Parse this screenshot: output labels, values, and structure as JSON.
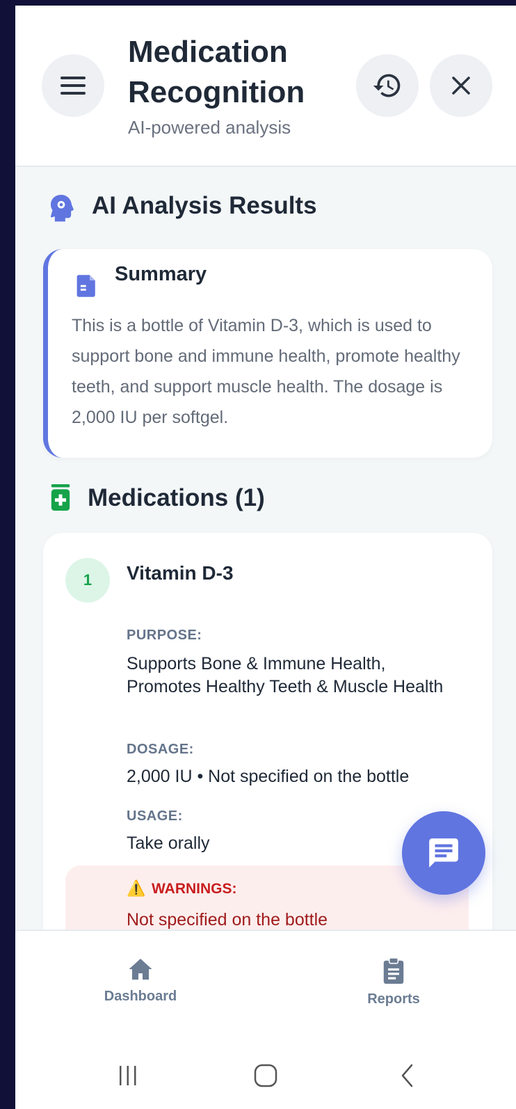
{
  "header": {
    "title": "Medication Recognition",
    "subtitle": "AI-powered analysis"
  },
  "analysis": {
    "title": "AI Analysis Results"
  },
  "summary": {
    "title": "Summary",
    "text": "This is a bottle of Vitamin D-3, which is used to support bone and immune health, promote healthy teeth, and support muscle health. The dosage is 2,000 IU per softgel."
  },
  "medications": {
    "title": "Medications (1)",
    "items": [
      {
        "number": "1",
        "name": "Vitamin D-3",
        "purpose_label": "PURPOSE:",
        "purpose": "Supports Bone & Immune Health, Promotes Healthy Teeth & Muscle Health",
        "dosage_label": "DOSAGE:",
        "dosage": "2,000 IU • Not specified on the bottle",
        "usage_label": "USAGE:",
        "usage": "Take orally",
        "warnings_label": "WARNINGS:",
        "warnings_icon": "⚠️",
        "warnings": "Not specified on the bottle"
      }
    ]
  },
  "nav": {
    "dashboard": "Dashboard",
    "reports": "Reports"
  },
  "colors": {
    "accent": "#6075e0",
    "success": "#16a34a",
    "danger": "#c81e1e"
  }
}
